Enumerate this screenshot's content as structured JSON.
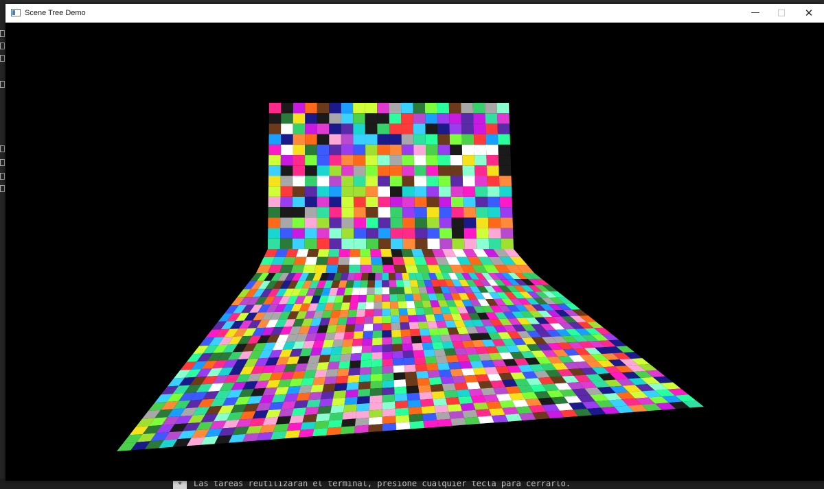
{
  "window": {
    "title": "Scene Tree Demo",
    "controls": {
      "minimize": "—",
      "maximize": "□",
      "close": "✕"
    }
  },
  "terminal": {
    "badge": "*",
    "message": "Las tareas reutilizarán el terminal, presione cualquier tecla para cerrarlo."
  },
  "scene": {
    "description_icon": "mesh-3d",
    "palette": [
      "#ff2a8a",
      "#36d16b",
      "#3b5bff",
      "#f5e21a",
      "#9a3df0",
      "#1ad6d0",
      "#ff6a1a",
      "#7cff3a",
      "#c81ae0",
      "#1a9eff",
      "#ff3a3a",
      "#2aff9e",
      "#5a2aa8",
      "#ffa8d8",
      "#8affd0",
      "#1a1a8a",
      "#e03ad0",
      "#4ad04a",
      "#ff8a3a",
      "#3ad0ff",
      "#a8a8a8",
      "#6a3a1a",
      "#d0ff3a",
      "#ff1ac8",
      "#2a7a3a",
      "#b84ad0",
      "#ffffff",
      "#1a1a1a",
      "#30e0a0",
      "#a0e030"
    ],
    "background": "#000000"
  }
}
